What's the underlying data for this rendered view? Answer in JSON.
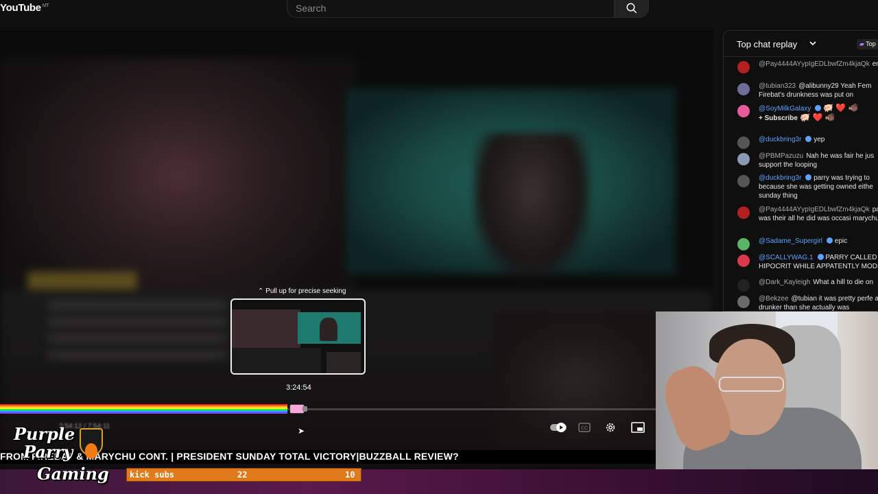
{
  "app": {
    "logo_text": "YouTube",
    "region": "MT"
  },
  "search": {
    "placeholder": "Search"
  },
  "player": {
    "seek_hint": "Pull up for precise seeking",
    "preview_time": "3:24:54",
    "progress_fraction": 0.33
  },
  "chat": {
    "title": "Top chat replay",
    "top_badge": "Top",
    "messages": [
      {
        "author": "@Pay4444AYypIgEDLbwfZm4kjaQk",
        "text": "enforcement",
        "member": false,
        "avatar_color": "#b32020"
      },
      {
        "author": "@tubian323",
        "text": "@alibunny29 Yeah Fem Firebat's drunkness was put on",
        "member": false,
        "avatar_color": "#6d6d9a"
      },
      {
        "author": "@SoyMilkGalaxy",
        "text": "",
        "member": true,
        "avatar_color": "#e85a9a",
        "line2": "+ Subscribe"
      },
      {
        "author": "@duckbring3r",
        "text": "yep",
        "member": true,
        "avatar_color": "#555555"
      },
      {
        "author": "@PBMPazuzu",
        "text": "Nah he was fair he jus support the looping",
        "member": false,
        "avatar_color": "#8a9ab5"
      },
      {
        "author": "@duckbring3r",
        "text": "parry was trying to because she was getting owned eithe sunday thing",
        "member": true,
        "avatar_color": "#555555"
      },
      {
        "author": "@Pay4444AYypIgEDLbwfZm4kjaQk",
        "text": "parry was their all he did was occasi marychu",
        "member": false,
        "avatar_color": "#b32020"
      },
      {
        "author": "@Sadame_Supergirl",
        "text": "epic",
        "member": true,
        "avatar_color": "#5bb36a"
      },
      {
        "author": "@SCALLYWAG.1",
        "text": "PARRY CALLED HIPOCRIT WHILE APPATENTLY MODI",
        "member": true,
        "avatar_color": "#d83a4a"
      },
      {
        "author": "@Dark_Kayleigh",
        "text": "What a hill to die on",
        "member": false,
        "avatar_color": "#222222"
      },
      {
        "author": "@Bekzee",
        "text": "@tubian it was pretty perfe acting drunker than she actually was",
        "member": false,
        "avatar_color": "#6a6a6a"
      }
    ]
  },
  "overlay": {
    "ticker": "FROM FIREBAT & MARYCHU CONT. | PRESIDENT SUNDAY TOTAL VICTORY|BUZZBALL REVIEW?",
    "brand_line1": "Purple",
    "brand_line2": "Parry",
    "brand_line3": "Gaming",
    "subs_label": "kick subs",
    "subs_current": "22",
    "subs_target": "10"
  },
  "colors": {
    "accent_blue": "#5ea2ff",
    "goal_orange": "#e07a1a",
    "bottom_bar": "#4a1a42"
  }
}
